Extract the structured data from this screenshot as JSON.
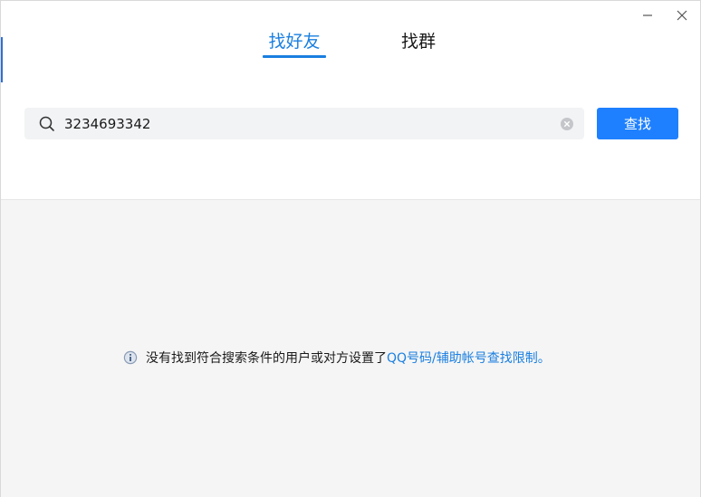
{
  "tabs": [
    {
      "label": "找好友",
      "active": true
    },
    {
      "label": "找群",
      "active": false
    }
  ],
  "search": {
    "value": "3234693342",
    "placeholder": ""
  },
  "find_button": {
    "label": "查找"
  },
  "result": {
    "message_prefix": "没有找到符合搜索条件的用户或对方设置了",
    "message_link": "QQ号码/辅助帐号查找限制",
    "message_suffix": "。"
  },
  "icons": {
    "minimize": "minimize-icon",
    "close": "close-icon",
    "search": "search-icon",
    "clear": "clear-icon",
    "info": "info-icon"
  },
  "colors": {
    "accent": "#1e80ff",
    "tab_active": "#1a7fe0",
    "result_bg": "#f5f5f5",
    "search_bg": "#f2f3f5"
  }
}
